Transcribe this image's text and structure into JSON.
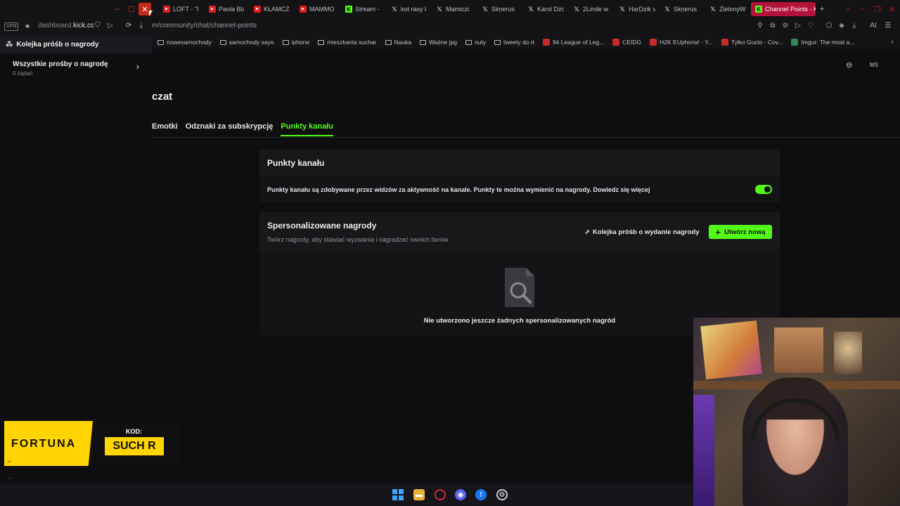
{
  "browser": {
    "tabs": [
      {
        "label": "LOFT - \"I",
        "icon": "youtube"
      },
      {
        "label": "Paola Bla",
        "icon": "youtube"
      },
      {
        "label": "KŁAMCZ",
        "icon": "youtube"
      },
      {
        "label": "MAMMO",
        "icon": "youtube"
      },
      {
        "label": "Stream -",
        "icon": "kick"
      },
      {
        "label": "kot rasy k",
        "icon": "x"
      },
      {
        "label": "Mamiczi",
        "icon": "x"
      },
      {
        "label": "Skṇerus",
        "icon": "x"
      },
      {
        "label": "Karol Dżo",
        "icon": "x"
      },
      {
        "label": "2Linde w",
        "icon": "x"
      },
      {
        "label": "HarDzik v",
        "icon": "x"
      },
      {
        "label": "Skṇerus",
        "icon": "x"
      },
      {
        "label": "ZielonyW",
        "icon": "x"
      },
      {
        "label": "Channel Points - K",
        "icon": "kick",
        "active": true
      }
    ],
    "vpn_label": "VPN",
    "address_host_prefix": "dashboard.",
    "address_host": "kick.cc",
    "address_path": "m/community/chat/channel-points",
    "bookmarks": [
      {
        "label": "nowesamochody",
        "type": "folder"
      },
      {
        "label": "samochody xayo",
        "type": "folder"
      },
      {
        "label": "iphone",
        "type": "folder"
      },
      {
        "label": "mieszkania suchar",
        "type": "folder"
      },
      {
        "label": "Nauka",
        "type": "folder"
      },
      {
        "label": "Ważne jpg",
        "type": "folder"
      },
      {
        "label": "nuty",
        "type": "folder"
      },
      {
        "label": "tweety do rt",
        "type": "folder"
      },
      {
        "label": "94 League of Leg...",
        "type": "site"
      },
      {
        "label": "CEIDG",
        "type": "site"
      },
      {
        "label": "H2K EUphoria! - Y...",
        "type": "site"
      },
      {
        "label": "Tylko Gucio - Cov...",
        "type": "site"
      },
      {
        "label": "Imgur: The most a...",
        "type": "site"
      }
    ],
    "ai_label": "AI"
  },
  "left_panel": {
    "header": "Kolejka próśb o nagrody",
    "item_title": "Wszystkie prośby o nagrodę",
    "item_sub": "0 żądań"
  },
  "main": {
    "avatar": "MS",
    "page_title": "czat",
    "tabs": [
      {
        "label": "Emotki"
      },
      {
        "label": "Odznaki za subskrypcję"
      },
      {
        "label": "Punkty kanału",
        "active": true
      }
    ],
    "points_card": {
      "title": "Punkty kanału",
      "description": "Punkty kanału są zdobywane przez widzów za aktywność na kanale. Punkty te można wymienić na nagrody. Dowiedz się więcej",
      "enabled": true
    },
    "rewards_card": {
      "title": "Spersonalizowane nagrody",
      "subtitle": "Twórz nagrody, aby stawiać wyzwania i nagradzać swoich fanów",
      "queue_button": "Kolejka próśb o wydanie nagrody",
      "create_button": "Utwórz nową",
      "empty_text": "Nie utworzono jeszcze żadnych spersonalizowanych nagród"
    }
  },
  "overlay_ad": {
    "brand": "FORTUNA",
    "code_label": "KOD:",
    "code": "SUCH R"
  },
  "colors": {
    "accent": "#53fc18",
    "background": "#0e0e10",
    "card": "#18181b",
    "active_tab": "#b3123a"
  }
}
